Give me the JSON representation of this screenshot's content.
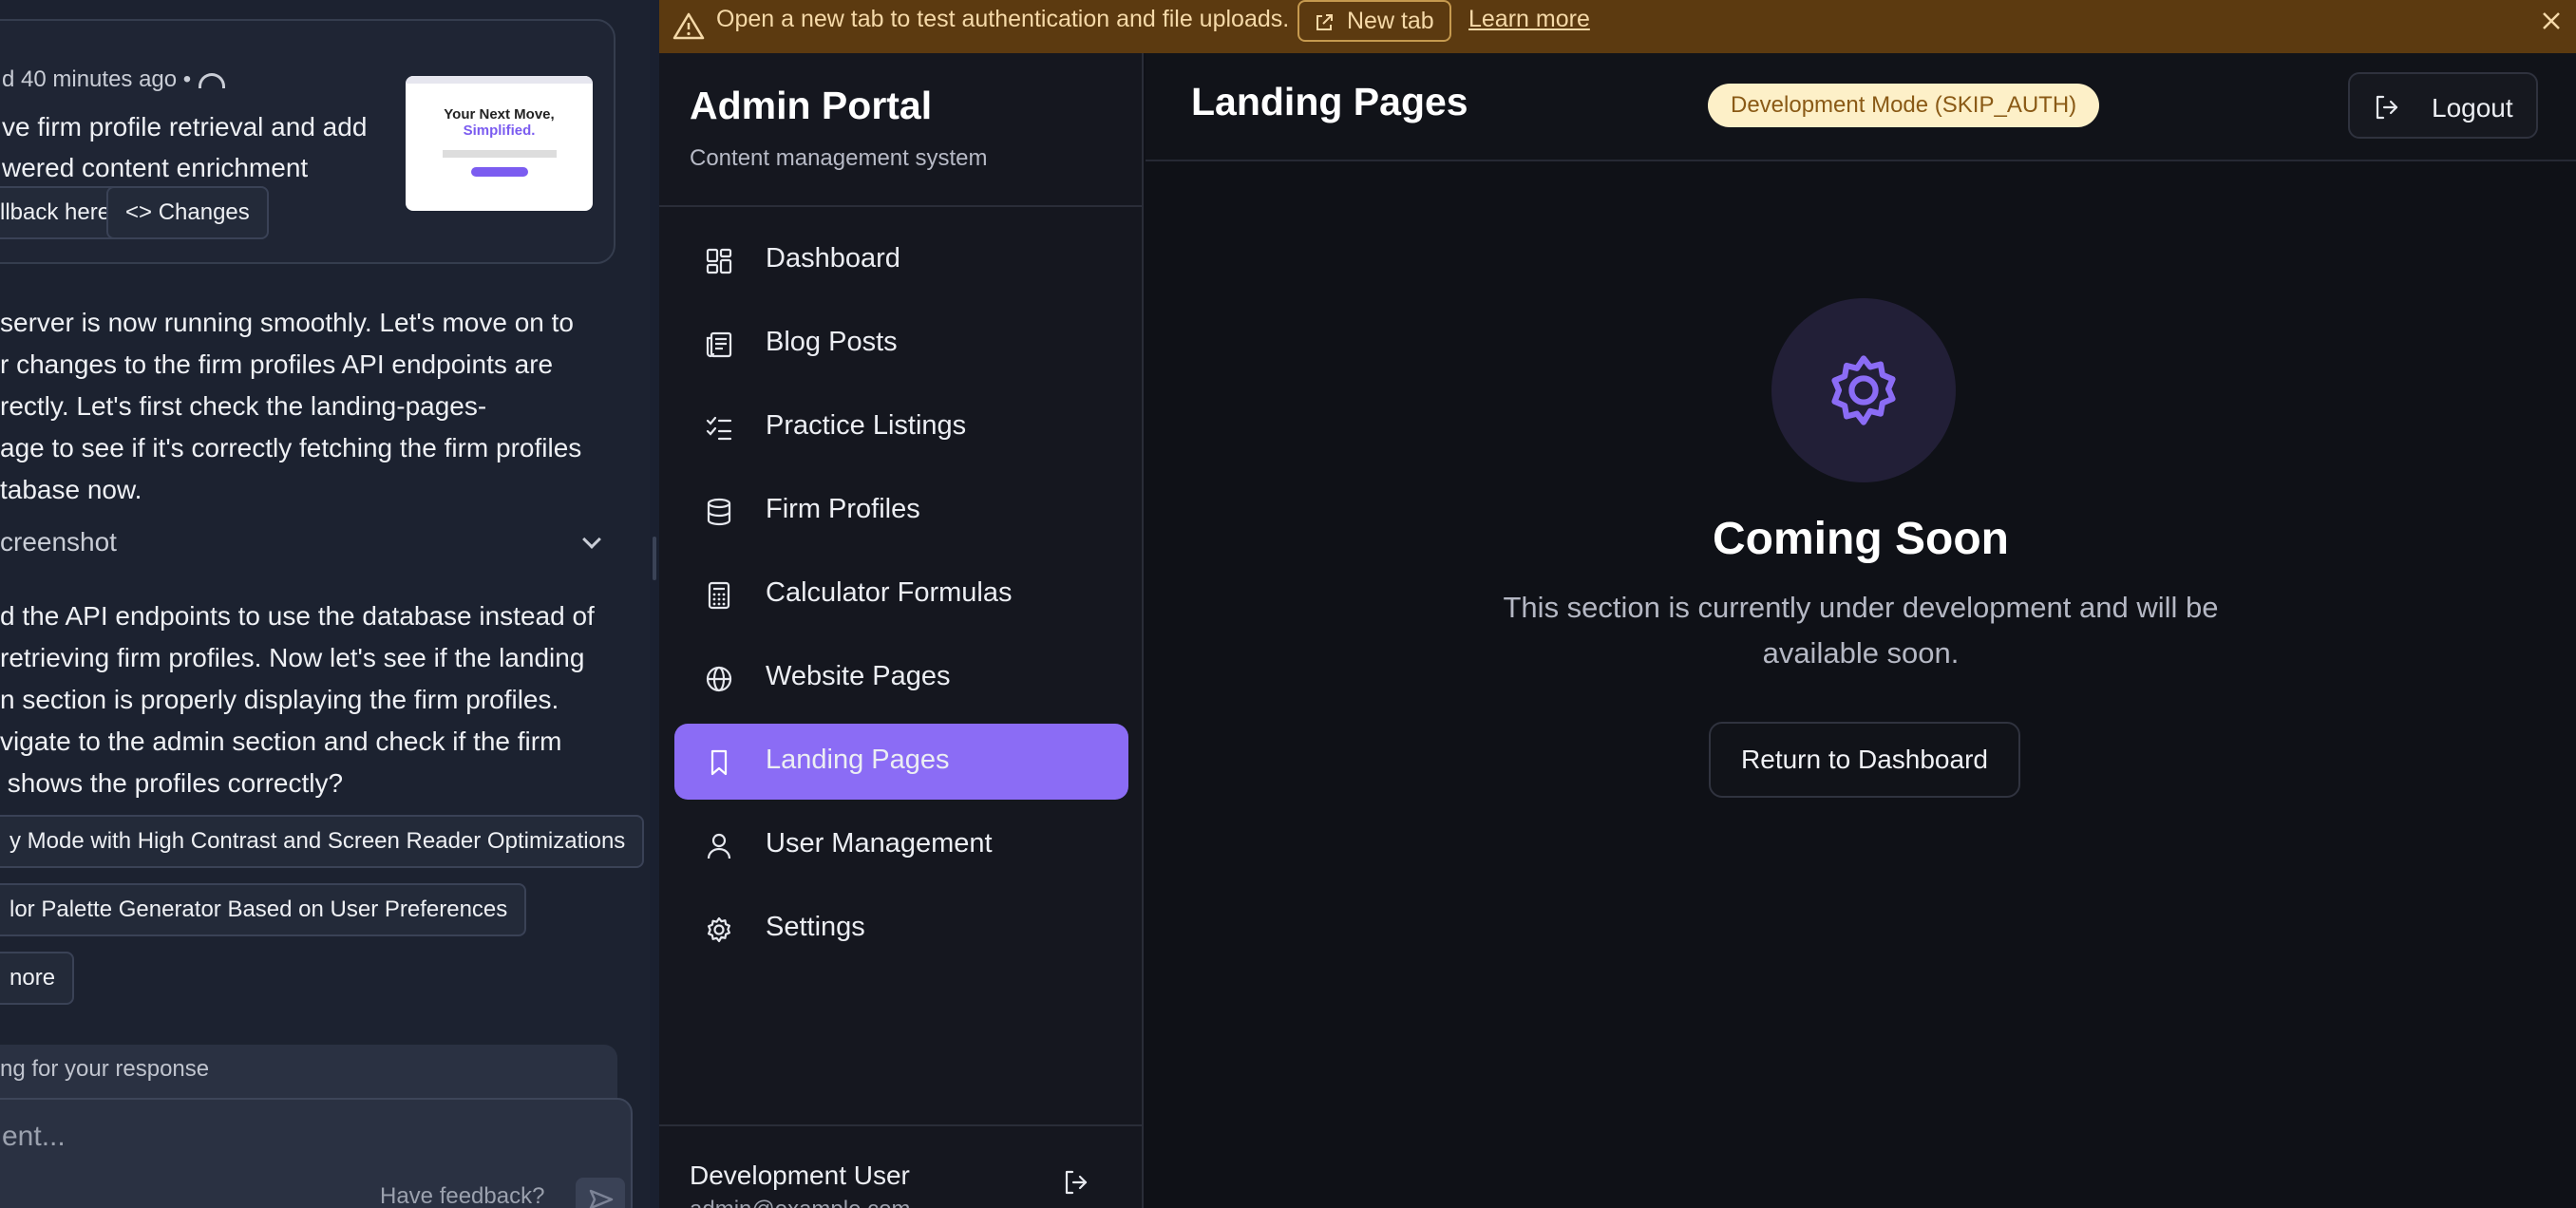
{
  "chat": {
    "commit_meta": "d 40 minutes ago  •",
    "commit_title": "ve firm profile retrieval and add\nwered content enrichment",
    "thumb": {
      "headline": "Your Next Move,",
      "highlight": "Simplified."
    },
    "rollback_label": "llback here",
    "changes_label": "<> Changes",
    "paragraph1": "server is now running smoothly. Let's move on to\nr changes to the firm profiles API endpoints are\nrectly. Let's first check the landing-pages-\nage to see if it's correctly fetching the firm profiles\ntabase now.",
    "screenshot_label": "creenshot",
    "paragraph2": "d the API endpoints to use the database instead of\nretrieving firm profiles. Now let's see if the landing\nn section is properly displaying the firm profiles.\nvigate to the admin section and check if the firm\n shows the profiles correctly?",
    "suggestion1": "y Mode with High Contrast and Screen Reader Optimizations",
    "suggestion2": "lor Palette Generator Based on User Preferences",
    "more_label": "nore",
    "waiting_text": "ng for your response",
    "composer_placeholder": "ent...",
    "feedback_label": "Have feedback?"
  },
  "banner": {
    "message": "Open a new tab to test authentication and file uploads.",
    "new_tab_label": "New tab",
    "learn_more_label": "Learn more"
  },
  "sidebar": {
    "title": "Admin Portal",
    "subtitle": "Content management system",
    "items": [
      {
        "label": "Dashboard",
        "icon": "dashboard-icon"
      },
      {
        "label": "Blog Posts",
        "icon": "newspaper-icon"
      },
      {
        "label": "Practice Listings",
        "icon": "checklist-icon"
      },
      {
        "label": "Firm Profiles",
        "icon": "database-icon"
      },
      {
        "label": "Calculator Formulas",
        "icon": "calculator-icon"
      },
      {
        "label": "Website Pages",
        "icon": "globe-icon"
      },
      {
        "label": "Landing Pages",
        "icon": "bookmark-icon",
        "active": true
      },
      {
        "label": "User Management",
        "icon": "user-icon"
      },
      {
        "label": "Settings",
        "icon": "gear-icon"
      }
    ],
    "user_name": "Development User",
    "user_email": "admin@example.com"
  },
  "main": {
    "page_title": "Landing Pages",
    "mode_badge": "Development Mode (SKIP_AUTH)",
    "logout_label": "Logout",
    "coming_soon_title": "Coming Soon",
    "coming_soon_desc": "This section is currently under development and will be available soon.",
    "return_label": "Return to Dashboard"
  },
  "colors": {
    "accent": "#8b6cf5",
    "banner_bg": "#5c3a10",
    "badge_bg": "#fdf0c8"
  }
}
